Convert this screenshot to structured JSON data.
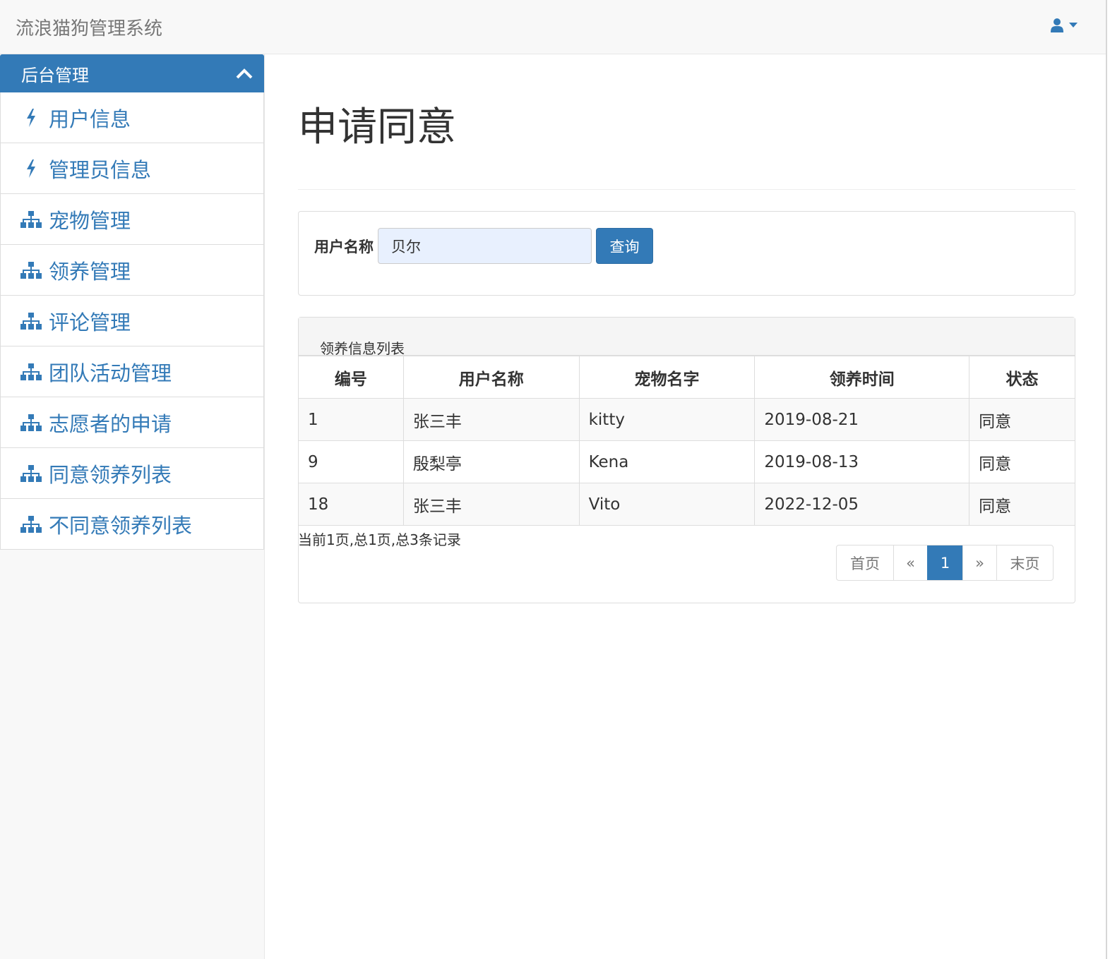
{
  "app": {
    "title": "流浪猫狗管理系统"
  },
  "sidebar": {
    "heading": "后台管理",
    "items": [
      {
        "label": "用户信息",
        "icon": "bolt-icon"
      },
      {
        "label": "管理员信息",
        "icon": "bolt-icon"
      },
      {
        "label": "宠物管理",
        "icon": "sitemap-icon"
      },
      {
        "label": "领养管理",
        "icon": "sitemap-icon"
      },
      {
        "label": "评论管理",
        "icon": "sitemap-icon"
      },
      {
        "label": "团队活动管理",
        "icon": "sitemap-icon"
      },
      {
        "label": "志愿者的申请",
        "icon": "sitemap-icon"
      },
      {
        "label": "同意领养列表",
        "icon": "sitemap-icon"
      },
      {
        "label": "不同意领养列表",
        "icon": "sitemap-icon"
      }
    ]
  },
  "main": {
    "title": "申请同意",
    "search": {
      "label": "用户名称",
      "value": "贝尔",
      "button": "查询"
    },
    "list": {
      "heading": "领养信息列表",
      "columns": [
        "编号",
        "用户名称",
        "宠物名字",
        "领养时间",
        "状态"
      ],
      "rows": [
        [
          "1",
          "张三丰",
          "kitty",
          "2019-08-21",
          "同意"
        ],
        [
          "9",
          "殷梨亭",
          "Kena",
          "2019-08-13",
          "同意"
        ],
        [
          "18",
          "张三丰",
          "Vito",
          "2022-12-05",
          "同意"
        ]
      ],
      "records": "当前1页,总1页,总3条记录"
    },
    "pager": {
      "first": "首页",
      "prev": "«",
      "current": "1",
      "next": "»",
      "last": "末页"
    }
  },
  "colors": {
    "primary": "#337ab7",
    "navbar": "#f8f8f8"
  }
}
